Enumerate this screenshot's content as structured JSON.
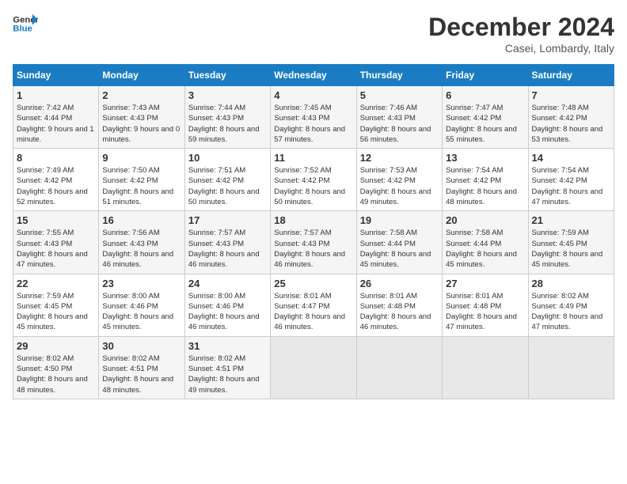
{
  "header": {
    "logo_line1": "General",
    "logo_line2": "Blue",
    "month": "December 2024",
    "location": "Casei, Lombardy, Italy"
  },
  "weekdays": [
    "Sunday",
    "Monday",
    "Tuesday",
    "Wednesday",
    "Thursday",
    "Friday",
    "Saturday"
  ],
  "weeks": [
    [
      {
        "day": "1",
        "sunrise": "7:42 AM",
        "sunset": "4:44 PM",
        "daylight": "9 hours and 1 minute."
      },
      {
        "day": "2",
        "sunrise": "7:43 AM",
        "sunset": "4:43 PM",
        "daylight": "9 hours and 0 minutes."
      },
      {
        "day": "3",
        "sunrise": "7:44 AM",
        "sunset": "4:43 PM",
        "daylight": "8 hours and 59 minutes."
      },
      {
        "day": "4",
        "sunrise": "7:45 AM",
        "sunset": "4:43 PM",
        "daylight": "8 hours and 57 minutes."
      },
      {
        "day": "5",
        "sunrise": "7:46 AM",
        "sunset": "4:43 PM",
        "daylight": "8 hours and 56 minutes."
      },
      {
        "day": "6",
        "sunrise": "7:47 AM",
        "sunset": "4:42 PM",
        "daylight": "8 hours and 55 minutes."
      },
      {
        "day": "7",
        "sunrise": "7:48 AM",
        "sunset": "4:42 PM",
        "daylight": "8 hours and 53 minutes."
      }
    ],
    [
      {
        "day": "8",
        "sunrise": "7:49 AM",
        "sunset": "4:42 PM",
        "daylight": "8 hours and 52 minutes."
      },
      {
        "day": "9",
        "sunrise": "7:50 AM",
        "sunset": "4:42 PM",
        "daylight": "8 hours and 51 minutes."
      },
      {
        "day": "10",
        "sunrise": "7:51 AM",
        "sunset": "4:42 PM",
        "daylight": "8 hours and 50 minutes."
      },
      {
        "day": "11",
        "sunrise": "7:52 AM",
        "sunset": "4:42 PM",
        "daylight": "8 hours and 50 minutes."
      },
      {
        "day": "12",
        "sunrise": "7:53 AM",
        "sunset": "4:42 PM",
        "daylight": "8 hours and 49 minutes."
      },
      {
        "day": "13",
        "sunrise": "7:54 AM",
        "sunset": "4:42 PM",
        "daylight": "8 hours and 48 minutes."
      },
      {
        "day": "14",
        "sunrise": "7:54 AM",
        "sunset": "4:42 PM",
        "daylight": "8 hours and 47 minutes."
      }
    ],
    [
      {
        "day": "15",
        "sunrise": "7:55 AM",
        "sunset": "4:43 PM",
        "daylight": "8 hours and 47 minutes."
      },
      {
        "day": "16",
        "sunrise": "7:56 AM",
        "sunset": "4:43 PM",
        "daylight": "8 hours and 46 minutes."
      },
      {
        "day": "17",
        "sunrise": "7:57 AM",
        "sunset": "4:43 PM",
        "daylight": "8 hours and 46 minutes."
      },
      {
        "day": "18",
        "sunrise": "7:57 AM",
        "sunset": "4:43 PM",
        "daylight": "8 hours and 46 minutes."
      },
      {
        "day": "19",
        "sunrise": "7:58 AM",
        "sunset": "4:44 PM",
        "daylight": "8 hours and 45 minutes."
      },
      {
        "day": "20",
        "sunrise": "7:58 AM",
        "sunset": "4:44 PM",
        "daylight": "8 hours and 45 minutes."
      },
      {
        "day": "21",
        "sunrise": "7:59 AM",
        "sunset": "4:45 PM",
        "daylight": "8 hours and 45 minutes."
      }
    ],
    [
      {
        "day": "22",
        "sunrise": "7:59 AM",
        "sunset": "4:45 PM",
        "daylight": "8 hours and 45 minutes."
      },
      {
        "day": "23",
        "sunrise": "8:00 AM",
        "sunset": "4:46 PM",
        "daylight": "8 hours and 45 minutes."
      },
      {
        "day": "24",
        "sunrise": "8:00 AM",
        "sunset": "4:46 PM",
        "daylight": "8 hours and 46 minutes."
      },
      {
        "day": "25",
        "sunrise": "8:01 AM",
        "sunset": "4:47 PM",
        "daylight": "8 hours and 46 minutes."
      },
      {
        "day": "26",
        "sunrise": "8:01 AM",
        "sunset": "4:48 PM",
        "daylight": "8 hours and 46 minutes."
      },
      {
        "day": "27",
        "sunrise": "8:01 AM",
        "sunset": "4:48 PM",
        "daylight": "8 hours and 47 minutes."
      },
      {
        "day": "28",
        "sunrise": "8:02 AM",
        "sunset": "4:49 PM",
        "daylight": "8 hours and 47 minutes."
      }
    ],
    [
      {
        "day": "29",
        "sunrise": "8:02 AM",
        "sunset": "4:50 PM",
        "daylight": "8 hours and 48 minutes."
      },
      {
        "day": "30",
        "sunrise": "8:02 AM",
        "sunset": "4:51 PM",
        "daylight": "8 hours and 48 minutes."
      },
      {
        "day": "31",
        "sunrise": "8:02 AM",
        "sunset": "4:51 PM",
        "daylight": "8 hours and 49 minutes."
      },
      null,
      null,
      null,
      null
    ]
  ]
}
